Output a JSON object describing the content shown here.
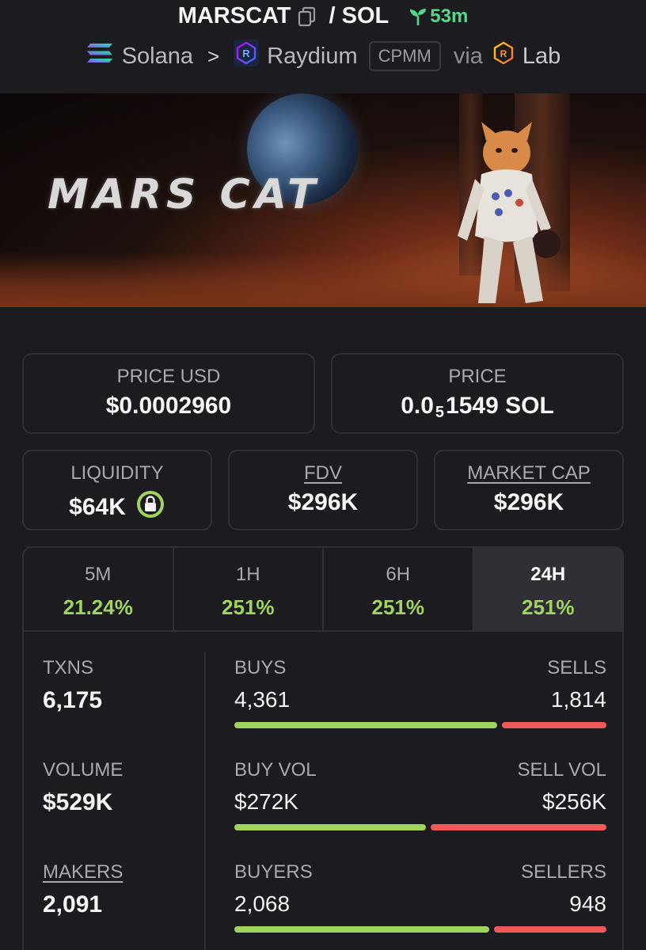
{
  "header": {
    "token": "MARSCAT",
    "quote": "/ SOL",
    "age": "53m",
    "chain": "Solana",
    "dex": "Raydium",
    "pool_type": "CPMM",
    "via": "via",
    "launchpad": "Lab",
    "colors": {
      "age": "#56d88a",
      "solana_a": "#9945ff",
      "solana_b": "#14f195"
    }
  },
  "banner": {
    "logo_text": "MARS CAT"
  },
  "price_usd": {
    "label": "PRICE USD",
    "value": "$0.0002960"
  },
  "price_native": {
    "label": "PRICE",
    "prefix": "0.0",
    "zeros": "5",
    "digits": "1549 SOL"
  },
  "liquidity": {
    "label": "LIQUIDITY",
    "value": "$64K"
  },
  "fdv": {
    "label": "FDV",
    "value": "$296K"
  },
  "market_cap": {
    "label": "MARKET CAP",
    "value": "$296K"
  },
  "timeframes": [
    {
      "label": "5M",
      "change": "21.24%",
      "active": false
    },
    {
      "label": "1H",
      "change": "251%",
      "active": false
    },
    {
      "label": "6H",
      "change": "251%",
      "active": false
    },
    {
      "label": "24H",
      "change": "251%",
      "active": true
    }
  ],
  "stats": {
    "txns": {
      "label": "TXNS",
      "value": "6,175",
      "buys_label": "BUYS",
      "buys": "4,361",
      "sells_label": "SELLS",
      "sells": "1,814",
      "buy_ratio": 0.706
    },
    "volume": {
      "label": "VOLUME",
      "value": "$529K",
      "buys_label": "BUY VOL",
      "buys": "$272K",
      "sells_label": "SELL VOL",
      "sells": "$256K",
      "buy_ratio": 0.515
    },
    "makers": {
      "label": "MAKERS",
      "value": "2,091",
      "buys_label": "BUYERS",
      "buys": "2,068",
      "sells_label": "SELLERS",
      "sells": "948",
      "buy_ratio": 0.686
    }
  },
  "colors": {
    "positive": "#9fd45f",
    "negative": "#ef5a58",
    "background": "#1b1b20"
  }
}
